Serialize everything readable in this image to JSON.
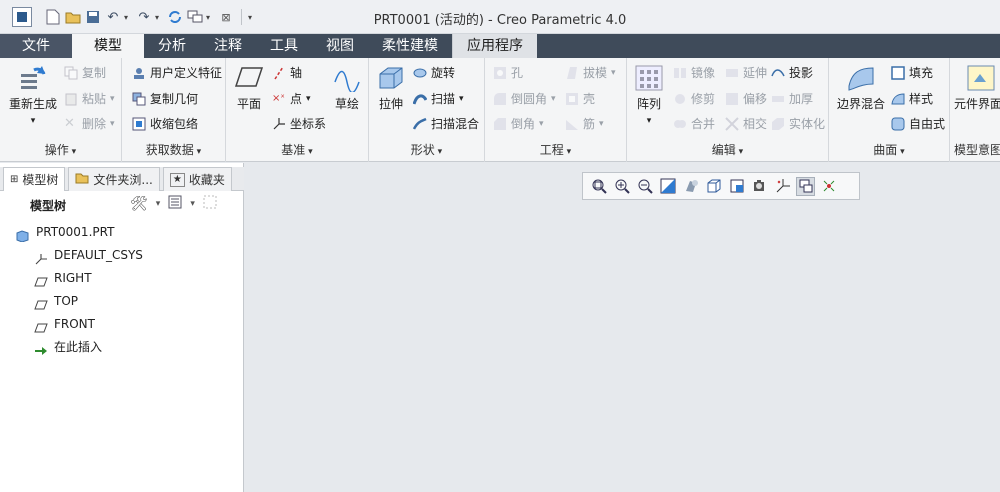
{
  "window": {
    "title": "PRT0001 (活动的) - Creo Parametric 4.0"
  },
  "tabs": [
    {
      "label": "文件",
      "kind": "file"
    },
    {
      "label": "模型",
      "kind": "active"
    },
    {
      "label": "分析",
      "kind": "normal"
    },
    {
      "label": "注释",
      "kind": "normal"
    },
    {
      "label": "工具",
      "kind": "normal"
    },
    {
      "label": "视图",
      "kind": "normal"
    },
    {
      "label": "柔性建模",
      "kind": "normal"
    },
    {
      "label": "应用程序",
      "kind": "light"
    }
  ],
  "ribbon": {
    "operations": {
      "label": "操作",
      "regenerate": "重新生成",
      "copy": "复制",
      "paste": "粘贴",
      "delete": "删除"
    },
    "get_data": {
      "label": "获取数据",
      "udf": "用户定义特征",
      "copy_geom": "复制几何",
      "shrinkwrap": "收缩包络"
    },
    "datum": {
      "label": "基准",
      "plane": "平面",
      "axis": "轴",
      "point": "点",
      "csys": "坐标系",
      "sketch": "草绘"
    },
    "shapes": {
      "label": "形状",
      "extrude": "拉伸",
      "revolve": "旋转",
      "sweep": "扫描",
      "swept_blend": "扫描混合"
    },
    "engineering": {
      "label": "工程",
      "hole": "孔",
      "draft": "拔模",
      "round": "倒圆角",
      "shell": "壳",
      "chamfer": "倒角",
      "rib": "筋"
    },
    "editing": {
      "label": "编辑",
      "pattern": "阵列",
      "mirror": "镜像",
      "extend": "延伸",
      "project": "投影",
      "trim": "修剪",
      "offset": "偏移",
      "thicken": "加厚",
      "merge": "合并",
      "intersect": "相交",
      "solidify": "实体化"
    },
    "surfaces": {
      "label": "曲面",
      "boundary_blend": "边界混合",
      "fill": "填充",
      "style": "样式",
      "freestyle": "自由式"
    },
    "model_intent": {
      "label": "模型意图",
      "component_interface": "元件界面"
    }
  },
  "panel": {
    "tabs": [
      "模型树",
      "文件夹浏...",
      "收藏夹"
    ],
    "toolbar_label": "模型树",
    "tree": [
      {
        "label": "PRT0001.PRT",
        "icon": "part-icon",
        "indent": 0
      },
      {
        "label": "DEFAULT_CSYS",
        "icon": "csys-icon",
        "indent": 1
      },
      {
        "label": "RIGHT",
        "icon": "datum-plane-icon",
        "indent": 1
      },
      {
        "label": "TOP",
        "icon": "datum-plane-icon",
        "indent": 1
      },
      {
        "label": "FRONT",
        "icon": "datum-plane-icon",
        "indent": 1
      },
      {
        "label": "在此插入",
        "icon": "insert-here-icon",
        "indent": 1
      }
    ]
  },
  "view_toolbar": {
    "icons": [
      "refit-icon",
      "zoom-in-icon",
      "zoom-out-icon",
      "repaint-icon",
      "display-style-icon",
      "saved-orientations-icon",
      "view-manager-icon",
      "perspective-icon",
      "datum-display-icon",
      "spin-center-icon",
      "annotation-display-icon"
    ]
  },
  "colors": {
    "tab_bar": "#3f4b5a",
    "active_tab": "#f4f5f6",
    "ribbon": "#f4f5f6",
    "graphics_bg": "#e6e9ed",
    "accent_blue": "#2f7bd0"
  }
}
